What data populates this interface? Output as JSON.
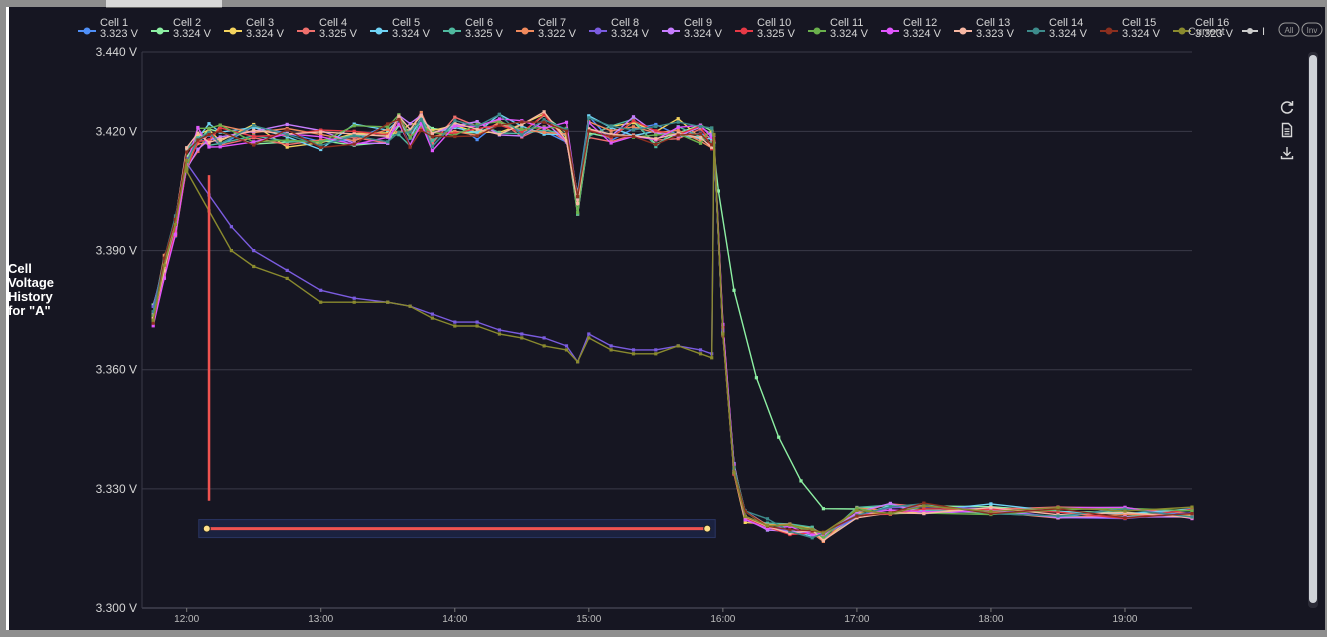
{
  "chart_data": {
    "type": "line",
    "title": "Cell Voltage History for \"A\"",
    "ylabel": "Cell Voltage History for \"A\"",
    "xlabel": "",
    "ylim": [
      3.3,
      3.44
    ],
    "xlim": [
      "11:40",
      "19:30"
    ],
    "yticks": [
      3.44,
      3.42,
      3.39,
      3.36,
      3.33,
      3.3
    ],
    "ytick_labels": [
      "3.440 V",
      "3.420 V",
      "3.390 V",
      "3.360 V",
      "3.330 V",
      "3.300 V"
    ],
    "xticks": [
      "12:00",
      "13:00",
      "14:00",
      "15:00",
      "16:00",
      "17:00",
      "18:00",
      "19:00"
    ],
    "grid": "horizontal",
    "legend_position": "top",
    "series": [
      {
        "name": "Cell 1",
        "legend_value": "3.323 V",
        "color": "#4f8ff7"
      },
      {
        "name": "Cell 2",
        "legend_value": "3.324 V",
        "color": "#8df0a3"
      },
      {
        "name": "Cell 3",
        "legend_value": "3.324 V",
        "color": "#f4d35e"
      },
      {
        "name": "Cell 4",
        "legend_value": "3.325 V",
        "color": "#ef6f6c"
      },
      {
        "name": "Cell 5",
        "legend_value": "3.324 V",
        "color": "#6fd3f5"
      },
      {
        "name": "Cell 6",
        "legend_value": "3.325 V",
        "color": "#4fb99f"
      },
      {
        "name": "Cell 7",
        "legend_value": "3.322 V",
        "color": "#f08a5d"
      },
      {
        "name": "Cell 8",
        "legend_value": "3.324 V",
        "color": "#7b5ce0"
      },
      {
        "name": "Cell 9",
        "legend_value": "3.324 V",
        "color": "#c77dff"
      },
      {
        "name": "Cell 10",
        "legend_value": "3.325 V",
        "color": "#e63946"
      },
      {
        "name": "Cell 11",
        "legend_value": "3.324 V",
        "color": "#6ab04c"
      },
      {
        "name": "Cell 12",
        "legend_value": "3.324 V",
        "color": "#e056fd"
      },
      {
        "name": "Cell 13",
        "legend_value": "3.323 V",
        "color": "#f7b7a3"
      },
      {
        "name": "Cell 14",
        "legend_value": "3.324 V",
        "color": "#3d8b8b"
      },
      {
        "name": "Cell 15",
        "legend_value": "3.324 V",
        "color": "#8b2f1f"
      },
      {
        "name": "Cell 16",
        "legend_value": "3.323 V",
        "color": "#8a8a2e"
      }
    ],
    "extra_legend": [
      {
        "name": "Current",
        "color": "#cccccc"
      },
      {
        "name": "I",
        "color": "#cccccc"
      }
    ],
    "toggle_labels": [
      "All",
      "Inv"
    ],
    "high_group": {
      "x": [
        "11:45",
        "11:50",
        "11:55",
        "12:00",
        "12:05",
        "12:10",
        "12:15",
        "12:30",
        "12:45",
        "13:00",
        "13:15",
        "13:30",
        "13:35",
        "13:40",
        "13:45",
        "13:50",
        "14:00",
        "14:10",
        "14:20",
        "14:30",
        "14:40",
        "14:50",
        "14:55",
        "15:00",
        "15:10",
        "15:20",
        "15:30",
        "15:40",
        "15:50",
        "15:55"
      ],
      "y": [
        3.374,
        3.386,
        3.396,
        3.413,
        3.418,
        3.419,
        3.419,
        3.419,
        3.419,
        3.418,
        3.419,
        3.42,
        3.422,
        3.419,
        3.422,
        3.418,
        3.421,
        3.42,
        3.422,
        3.42,
        3.422,
        3.42,
        3.402,
        3.421,
        3.42,
        3.421,
        3.419,
        3.421,
        3.42,
        3.418
      ],
      "spread": 0.003
    },
    "low_group": {
      "x": [
        "12:00",
        "12:10",
        "12:20",
        "12:30",
        "12:45",
        "13:00",
        "13:15",
        "13:30",
        "13:40",
        "13:50",
        "14:00",
        "14:10",
        "14:20",
        "14:30",
        "14:40",
        "14:50",
        "14:55",
        "15:00",
        "15:10",
        "15:20",
        "15:30",
        "15:40",
        "15:50",
        "15:55"
      ],
      "cell8_y": [
        3.412,
        3.404,
        3.396,
        3.39,
        3.385,
        3.38,
        3.378,
        3.377,
        3.376,
        3.374,
        3.372,
        3.372,
        3.37,
        3.369,
        3.368,
        3.366,
        3.362,
        3.369,
        3.366,
        3.365,
        3.365,
        3.366,
        3.365,
        3.364
      ],
      "cell16_y": [
        3.41,
        3.4,
        3.39,
        3.386,
        3.383,
        3.377,
        3.377,
        3.377,
        3.376,
        3.373,
        3.371,
        3.371,
        3.369,
        3.368,
        3.366,
        3.365,
        3.362,
        3.368,
        3.365,
        3.364,
        3.364,
        3.366,
        3.364,
        3.363
      ]
    },
    "discharge_end": {
      "x": [
        "15:56",
        "16:00",
        "16:05",
        "16:10",
        "16:20",
        "16:30",
        "16:40",
        "16:45",
        "17:00",
        "17:15",
        "17:30",
        "18:00",
        "18:30",
        "19:00",
        "19:30"
      ],
      "y": [
        3.418,
        3.37,
        3.335,
        3.323,
        3.321,
        3.32,
        3.319,
        3.318,
        3.324,
        3.325,
        3.325,
        3.325,
        3.324,
        3.324,
        3.324
      ]
    },
    "cell2_lagging_decay": {
      "x": [
        "15:58",
        "16:05",
        "16:15",
        "16:25",
        "16:35",
        "16:45"
      ],
      "y": [
        3.405,
        3.38,
        3.358,
        3.343,
        3.332,
        3.325
      ]
    },
    "annotation": {
      "vertical_marker": {
        "x": "12:10",
        "y_from": 3.409,
        "y_to": 3.327,
        "color": "#ef5350"
      },
      "horizontal_marker": {
        "x_from": "12:09",
        "x_to": "15:53",
        "y": 3.32,
        "color": "#ef5350"
      }
    }
  },
  "toolbar": {
    "reset_icon": "refresh-icon",
    "data_icon": "document-icon",
    "download_icon": "download-icon"
  }
}
